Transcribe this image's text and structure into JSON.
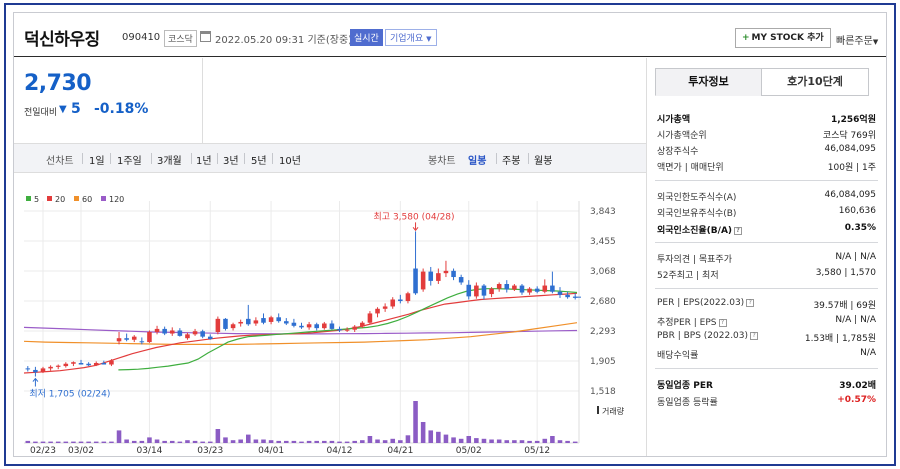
{
  "header": {
    "stock_name": "덕신하우징",
    "stock_code": "090410",
    "market": "코스닥",
    "datetime": "2022.05.20 09:31",
    "status": "기준(장중)",
    "realtime_label": "실시간",
    "company_label": "기업개요",
    "mystock_label": "MY STOCK 추가",
    "mystock_plus": "+",
    "quick_order_label": "빠른주문"
  },
  "price": {
    "current": "2,730",
    "change_label": "전일대비",
    "change_arrow": "▼",
    "change_value": "5",
    "change_percent": "-0.18%",
    "color": "#1560c7"
  },
  "period_bar": {
    "line_chart": "선차트",
    "periods": [
      "1일",
      "1주일",
      "3개월",
      "1년",
      "3년",
      "5년",
      "10년"
    ],
    "candle_chart": "봉차트",
    "candle_periods": [
      "일봉",
      "주봉",
      "월봉"
    ],
    "active_candle_period": "일봉"
  },
  "chart_data": {
    "type": "candlestick",
    "legend": [
      {
        "label": "5",
        "color": "#3fae3f"
      },
      {
        "label": "20",
        "color": "#e23c3c"
      },
      {
        "label": "60",
        "color": "#f0902a"
      },
      {
        "label": "120",
        "color": "#9a5cc8"
      }
    ],
    "x_ticks": [
      "02/23",
      "03/02",
      "03/14",
      "03/23",
      "04/01",
      "04/12",
      "04/21",
      "05/02",
      "05/12"
    ],
    "y_ticks": [
      "3,843",
      "3,455",
      "3,068",
      "2,680",
      "2,293",
      "1,905",
      "1,518"
    ],
    "ylim": [
      1518,
      3843
    ],
    "up_color": "#e23c3c",
    "down_color": "#2f6fd0",
    "volume_label": "거래량",
    "high_annotation": "최고 3,580 (04/28)",
    "low_annotation": "최저 1,705 (02/24)",
    "candles": [
      {
        "o": 1810,
        "h": 1840,
        "l": 1770,
        "c": 1800
      },
      {
        "o": 1790,
        "h": 1830,
        "l": 1705,
        "c": 1760
      },
      {
        "o": 1770,
        "h": 1830,
        "l": 1750,
        "c": 1810
      },
      {
        "o": 1810,
        "h": 1850,
        "l": 1780,
        "c": 1830
      },
      {
        "o": 1830,
        "h": 1860,
        "l": 1800,
        "c": 1845
      },
      {
        "o": 1840,
        "h": 1890,
        "l": 1820,
        "c": 1870
      },
      {
        "o": 1870,
        "h": 1900,
        "l": 1840,
        "c": 1890
      },
      {
        "o": 1880,
        "h": 1920,
        "l": 1860,
        "c": 1860
      },
      {
        "o": 1870,
        "h": 1890,
        "l": 1840,
        "c": 1850
      },
      {
        "o": 1850,
        "h": 1900,
        "l": 1840,
        "c": 1880
      },
      {
        "o": 1880,
        "h": 1910,
        "l": 1860,
        "c": 1860
      },
      {
        "o": 1860,
        "h": 1930,
        "l": 1840,
        "c": 1910
      },
      {
        "o": 2160,
        "h": 2280,
        "l": 2120,
        "c": 2200
      },
      {
        "o": 2200,
        "h": 2260,
        "l": 2160,
        "c": 2180
      },
      {
        "o": 2180,
        "h": 2240,
        "l": 2150,
        "c": 2220
      },
      {
        "o": 2160,
        "h": 2210,
        "l": 2120,
        "c": 2150
      },
      {
        "o": 2150,
        "h": 2300,
        "l": 2140,
        "c": 2280
      },
      {
        "o": 2280,
        "h": 2360,
        "l": 2250,
        "c": 2320
      },
      {
        "o": 2320,
        "h": 2350,
        "l": 2240,
        "c": 2260
      },
      {
        "o": 2260,
        "h": 2340,
        "l": 2230,
        "c": 2300
      },
      {
        "o": 2300,
        "h": 2330,
        "l": 2220,
        "c": 2230
      },
      {
        "o": 2200,
        "h": 2270,
        "l": 2180,
        "c": 2250
      },
      {
        "o": 2250,
        "h": 2320,
        "l": 2230,
        "c": 2290
      },
      {
        "o": 2290,
        "h": 2310,
        "l": 2200,
        "c": 2220
      },
      {
        "o": 2220,
        "h": 2250,
        "l": 2180,
        "c": 2190
      },
      {
        "o": 2280,
        "h": 2480,
        "l": 2250,
        "c": 2450
      },
      {
        "o": 2450,
        "h": 2460,
        "l": 2300,
        "c": 2320
      },
      {
        "o": 2330,
        "h": 2400,
        "l": 2300,
        "c": 2380
      },
      {
        "o": 2390,
        "h": 2440,
        "l": 2350,
        "c": 2410
      },
      {
        "o": 2450,
        "h": 2630,
        "l": 2360,
        "c": 2380
      },
      {
        "o": 2390,
        "h": 2470,
        "l": 2360,
        "c": 2430
      },
      {
        "o": 2460,
        "h": 2520,
        "l": 2380,
        "c": 2400
      },
      {
        "o": 2410,
        "h": 2490,
        "l": 2380,
        "c": 2470
      },
      {
        "o": 2470,
        "h": 2520,
        "l": 2400,
        "c": 2420
      },
      {
        "o": 2420,
        "h": 2460,
        "l": 2370,
        "c": 2390
      },
      {
        "o": 2400,
        "h": 2450,
        "l": 2340,
        "c": 2360
      },
      {
        "o": 2360,
        "h": 2400,
        "l": 2320,
        "c": 2340
      },
      {
        "o": 2340,
        "h": 2410,
        "l": 2310,
        "c": 2380
      },
      {
        "o": 2380,
        "h": 2400,
        "l": 2300,
        "c": 2330
      },
      {
        "o": 2330,
        "h": 2410,
        "l": 2310,
        "c": 2390
      },
      {
        "o": 2390,
        "h": 2430,
        "l": 2310,
        "c": 2320
      },
      {
        "o": 2320,
        "h": 2350,
        "l": 2280,
        "c": 2300
      },
      {
        "o": 2300,
        "h": 2340,
        "l": 2280,
        "c": 2310
      },
      {
        "o": 2310,
        "h": 2370,
        "l": 2280,
        "c": 2350
      },
      {
        "o": 2350,
        "h": 2420,
        "l": 2330,
        "c": 2400
      },
      {
        "o": 2400,
        "h": 2550,
        "l": 2380,
        "c": 2520
      },
      {
        "o": 2520,
        "h": 2600,
        "l": 2470,
        "c": 2580
      },
      {
        "o": 2580,
        "h": 2650,
        "l": 2540,
        "c": 2610
      },
      {
        "o": 2610,
        "h": 2730,
        "l": 2580,
        "c": 2700
      },
      {
        "o": 2700,
        "h": 2760,
        "l": 2650,
        "c": 2680
      },
      {
        "o": 2680,
        "h": 2800,
        "l": 2650,
        "c": 2780
      },
      {
        "o": 3100,
        "h": 3580,
        "l": 2760,
        "c": 2780
      },
      {
        "o": 2830,
        "h": 3100,
        "l": 2800,
        "c": 3060
      },
      {
        "o": 3060,
        "h": 3120,
        "l": 2880,
        "c": 2940
      },
      {
        "o": 2940,
        "h": 3100,
        "l": 2900,
        "c": 3040
      },
      {
        "o": 3040,
        "h": 3200,
        "l": 2990,
        "c": 3070
      },
      {
        "o": 3070,
        "h": 3100,
        "l": 2950,
        "c": 2990
      },
      {
        "o": 2990,
        "h": 3020,
        "l": 2890,
        "c": 2920
      },
      {
        "o": 2890,
        "h": 2950,
        "l": 2700,
        "c": 2740
      },
      {
        "o": 2740,
        "h": 2920,
        "l": 2710,
        "c": 2880
      },
      {
        "o": 2880,
        "h": 2900,
        "l": 2700,
        "c": 2750
      },
      {
        "o": 2770,
        "h": 2860,
        "l": 2730,
        "c": 2840
      },
      {
        "o": 2840,
        "h": 2920,
        "l": 2800,
        "c": 2900
      },
      {
        "o": 2900,
        "h": 2950,
        "l": 2790,
        "c": 2830
      },
      {
        "o": 2830,
        "h": 2900,
        "l": 2810,
        "c": 2880
      },
      {
        "o": 2880,
        "h": 2900,
        "l": 2760,
        "c": 2790
      },
      {
        "o": 2790,
        "h": 2860,
        "l": 2760,
        "c": 2840
      },
      {
        "o": 2840,
        "h": 2870,
        "l": 2780,
        "c": 2800
      },
      {
        "o": 2800,
        "h": 2960,
        "l": 2780,
        "c": 2880
      },
      {
        "o": 2880,
        "h": 3060,
        "l": 2780,
        "c": 2800
      },
      {
        "o": 2800,
        "h": 2860,
        "l": 2720,
        "c": 2760
      },
      {
        "o": 2760,
        "h": 2800,
        "l": 2710,
        "c": 2730
      },
      {
        "o": 2735,
        "h": 2780,
        "l": 2700,
        "c": 2730
      }
    ],
    "volume": [
      3,
      2,
      2,
      2,
      2,
      2,
      2,
      2,
      2,
      2,
      2,
      2,
      18,
      5,
      3,
      3,
      8,
      5,
      3,
      3,
      2,
      4,
      3,
      2,
      2,
      20,
      8,
      4,
      5,
      12,
      5,
      5,
      4,
      3,
      3,
      3,
      2,
      3,
      3,
      3,
      3,
      2,
      2,
      3,
      4,
      10,
      5,
      4,
      6,
      4,
      11,
      60,
      30,
      18,
      16,
      12,
      8,
      6,
      10,
      7,
      6,
      5,
      5,
      4,
      4,
      4,
      3,
      3,
      6,
      10,
      4,
      3,
      2
    ],
    "ma5": [
      1790,
      1795,
      1800,
      1810,
      1825,
      1840,
      1860,
      1880,
      1930,
      2010,
      2080,
      2150,
      2190,
      2220,
      2230,
      2240,
      2250,
      2260,
      2270,
      2280,
      2290,
      2300,
      2310,
      2320,
      2330,
      2340,
      2360,
      2390,
      2430,
      2480,
      2540,
      2600,
      2660,
      2720,
      2770,
      2810,
      2830,
      2840,
      2840,
      2835,
      2830,
      2825,
      2820,
      2815,
      2810,
      2800,
      2790
    ],
    "ma20": [
      1750,
      1760,
      1770,
      1780,
      1800,
      1820,
      1850,
      1900,
      1950,
      2000,
      2040,
      2080,
      2110,
      2140,
      2160,
      2180,
      2200,
      2215,
      2230,
      2240,
      2245,
      2250,
      2255,
      2260,
      2270,
      2285,
      2300,
      2320,
      2350,
      2390,
      2430,
      2470,
      2510,
      2560,
      2600,
      2640,
      2660,
      2680,
      2700,
      2710,
      2720,
      2730,
      2740,
      2750,
      2760,
      2770,
      2780
    ],
    "ma60": [
      2160,
      2150,
      2145,
      2140,
      2135,
      2130,
      2125,
      2120,
      2120,
      2120,
      2120,
      2125,
      2130,
      2135,
      2140,
      2145,
      2150,
      2160,
      2170,
      2180,
      2200,
      2220,
      2250,
      2280,
      2320,
      2360,
      2400
    ],
    "ma120": [
      2340,
      2330,
      2320,
      2310,
      2300,
      2290,
      2280,
      2275,
      2270,
      2265,
      2260,
      2258,
      2256,
      2255,
      2256,
      2258,
      2260,
      2262,
      2265,
      2268,
      2270,
      2275,
      2280,
      2285,
      2290,
      2295,
      2300
    ]
  },
  "investment_info": {
    "tabs": [
      "투자정보",
      "호가10단계"
    ],
    "rows": [
      {
        "label": "시가총액",
        "value": "1,256억원",
        "bold": true
      },
      {
        "label": "시가총액순위",
        "value": "코스닥 769위"
      },
      {
        "label": "상장주식수",
        "value": "46,084,095"
      },
      {
        "label": "액면가 | 매매단위",
        "value": "100원 | 1주"
      },
      {
        "label": "외국인한도주식수(A)",
        "value": "46,084,095"
      },
      {
        "label": "외국인보유주식수(B)",
        "value": "160,636"
      },
      {
        "label": "외국인소진율(B/A)",
        "value": "0.35%",
        "bold": true
      },
      {
        "label": "투자의견 | 목표주가",
        "value": "N/A | N/A"
      },
      {
        "label": "52주최고 | 최저",
        "value": "3,580 | 1,570"
      },
      {
        "label": "PER | EPS(2022.03)",
        "value": "39.57배 | 69원"
      },
      {
        "label": "추정PER | EPS",
        "value": "N/A | N/A"
      },
      {
        "label": "PBR | BPS (2022.03)",
        "value": "1.53배 | 1,785원"
      },
      {
        "label": "배당수익률",
        "value": "N/A"
      },
      {
        "label": "동일업종 PER",
        "value": "39.02배",
        "bold": true
      },
      {
        "label": "동일업종 등락률",
        "value": "+0.57%",
        "up": true
      }
    ]
  }
}
